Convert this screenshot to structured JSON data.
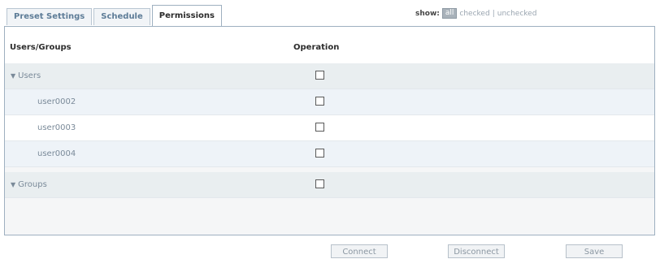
{
  "tabs": [
    {
      "label": "Preset Settings"
    },
    {
      "label": "Schedule"
    },
    {
      "label": "Permissions"
    }
  ],
  "filter": {
    "label": "show:",
    "all": "all",
    "checked": "checked",
    "separator": "|",
    "unchecked": "unchecked"
  },
  "table": {
    "col_users": "Users/Groups",
    "col_operation": "Operation",
    "rows": [
      {
        "label": "Users",
        "kind": "group",
        "checked": false
      },
      {
        "label": "user0002",
        "kind": "child",
        "checked": false
      },
      {
        "label": "user0003",
        "kind": "child",
        "checked": false
      },
      {
        "label": "user0004",
        "kind": "child",
        "checked": false
      },
      {
        "label": "Groups",
        "kind": "group",
        "checked": false
      }
    ]
  },
  "buttons": {
    "connect": "Connect",
    "disconnect": "Disconnect",
    "save": "Save"
  },
  "colors": {
    "group_row_bg": "#e9eef0",
    "child_row_alt_bg": "#eef3f8",
    "child_row_bg": "#ffffff"
  }
}
